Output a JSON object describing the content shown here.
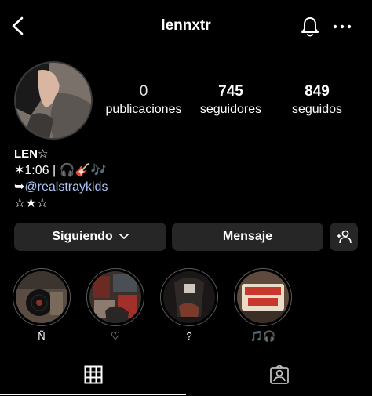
{
  "header": {
    "username": "lennxtr",
    "icons": [
      "back-icon",
      "bell-icon",
      "more-icon"
    ]
  },
  "profile": {
    "stats": [
      {
        "value": "0",
        "label": "publicaciones"
      },
      {
        "value": "745",
        "label": "seguidores"
      },
      {
        "value": "849",
        "label": "seguidos"
      }
    ],
    "name": "LEN☆",
    "bio": {
      "line1": "✶1:06 | 🎧🎸🎶",
      "arrow": "➥",
      "mention": "@realstraykids",
      "line3": "☆★☆"
    }
  },
  "actions": {
    "following_label": "Siguiendo",
    "message_label": "Mensaje"
  },
  "highlights": [
    {
      "label": "Ñ"
    },
    {
      "label": "♡"
    },
    {
      "label": "?"
    },
    {
      "label": "🎵🎧"
    }
  ],
  "tabs": {
    "active": "grid",
    "items": [
      "grid-icon",
      "tagged-icon"
    ]
  },
  "colors": {
    "background": "#000000",
    "button": "#262626",
    "mention": "#a9c6f5"
  }
}
